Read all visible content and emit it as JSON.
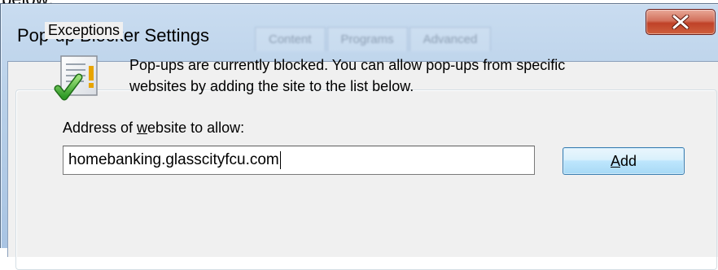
{
  "caption": {
    "text": "below:"
  },
  "window": {
    "title": "Pop-up Blocker Settings",
    "background_tabs": [
      "Content",
      "Programs",
      "Advanced"
    ],
    "close_icon": "close-x-icon"
  },
  "exceptions": {
    "group_title": "Exceptions",
    "description_line1": "Pop-ups are currently blocked.  You can allow pop-ups from specific",
    "description_line2": "websites by adding the site to the list below.",
    "info_icon": "notepad-checkmark-icon",
    "address_label_prefix": "Address of ",
    "address_label_underlined": "w",
    "address_label_suffix": "ebsite to allow:",
    "address_value": "homebanking.glasscityfcu.com",
    "add_button_underlined": "A",
    "add_button_suffix": "dd"
  },
  "colors": {
    "titlebar": "#b7cfe8",
    "client_background": "#f0f0f0",
    "close_button": "#c7462c",
    "add_button_border": "#3c7fb1"
  }
}
